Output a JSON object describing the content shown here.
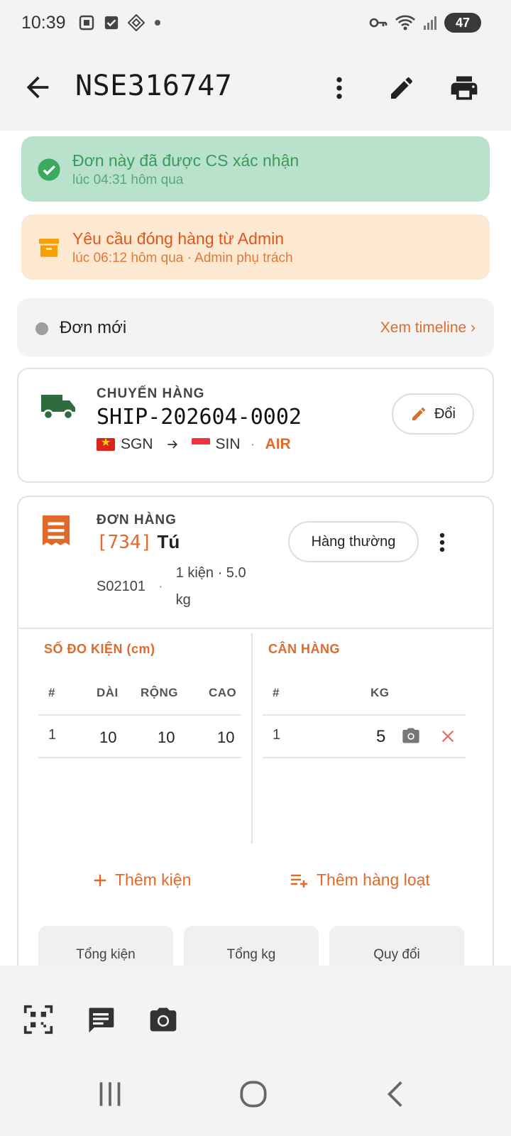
{
  "status_bar": {
    "time": "10:39",
    "battery": "47",
    "icons": [
      "screenshot-icon",
      "checkbox-icon",
      "app-icon",
      "dot-icon",
      "key-icon",
      "wifi-icon",
      "signal-icon",
      "battery-icon"
    ]
  },
  "app_bar": {
    "title": "NSE316747",
    "actions": [
      "more-vert-icon",
      "edit-icon",
      "print-icon"
    ]
  },
  "banners": {
    "confirmed": {
      "title": "Đơn này đã được CS xác nhận",
      "subtitle": "lúc 04:31 hôm qua"
    },
    "packing": {
      "title": "Yêu cầu đóng hàng từ Admin",
      "subtitle": "lúc 06:12 hôm qua · Admin phụ trách"
    }
  },
  "status": {
    "label": "Đơn mới",
    "timeline_link": "Xem timeline ›"
  },
  "shipment": {
    "label": "CHUYẾN HÀNG",
    "code": "SHIP-202604-0002",
    "origin": "SGN",
    "destination": "SIN",
    "mode": "AIR",
    "change_button": "Đổi"
  },
  "order": {
    "label": "ĐƠN HÀNG",
    "id": "[734]",
    "customer": "Tú",
    "code": "S02101",
    "separator": "·",
    "packages_summary": "1 kiện · 5.0 kg",
    "type_button": "Hàng thường"
  },
  "dimensions": {
    "title": "SỐ ĐO KIỆN (cm)",
    "columns": [
      "#",
      "DÀI",
      "RỘNG",
      "CAO"
    ],
    "rows": [
      [
        "1",
        "10",
        "10",
        "10"
      ]
    ]
  },
  "weights": {
    "title": "CÂN HÀNG",
    "columns": [
      "#",
      "KG"
    ],
    "rows": [
      [
        "1",
        "5"
      ]
    ]
  },
  "actions": {
    "add_package": "Thêm kiện",
    "bulk_add": "Thêm hàng loạt"
  },
  "summary": {
    "total_packages": "Tổng kiện",
    "total_kg": "Tổng kg",
    "converted": "Quy đổi"
  },
  "colors": {
    "accent": "#e06a2a",
    "success_bg": "#b8e2cc",
    "success_text": "#3a9a5a",
    "warning_bg": "#fde9d2",
    "truck": "#2e6b3e"
  }
}
